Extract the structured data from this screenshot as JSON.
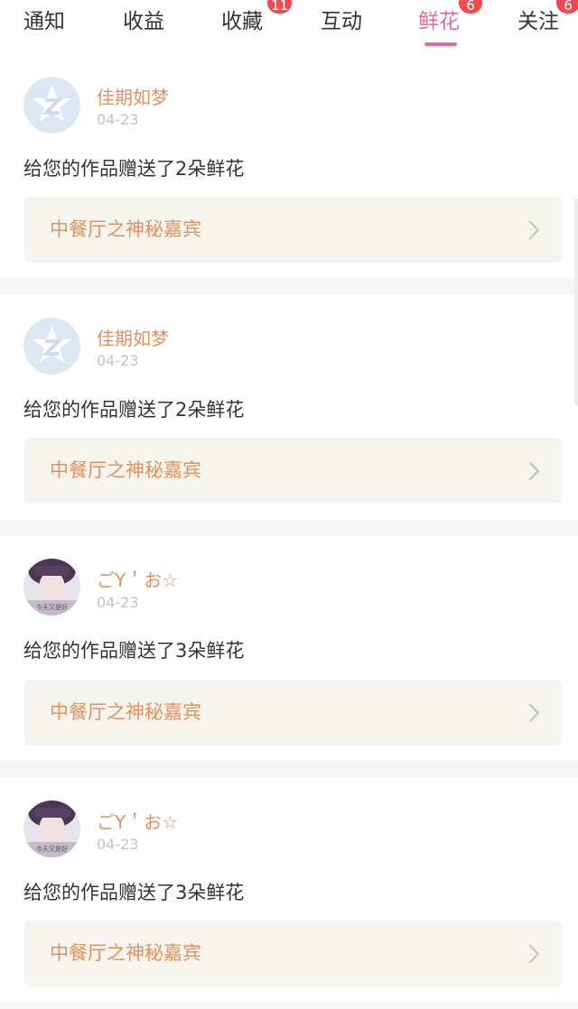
{
  "tabs": [
    {
      "label": "通知",
      "badge": ""
    },
    {
      "label": "收益",
      "badge": ""
    },
    {
      "label": "收藏",
      "badge": "11"
    },
    {
      "label": "互动",
      "badge": ""
    },
    {
      "label": "鲜花",
      "badge": "6"
    },
    {
      "label": "关注",
      "badge": "6"
    }
  ],
  "active_tab": "鲜花",
  "notifications": [
    {
      "user": "佳期如梦",
      "date": "04-23",
      "avatar": "qq-star-default-avatar",
      "message": "给您的作品赠送了2朵鲜花",
      "work": "中餐厅之神秘嘉宾"
    },
    {
      "user": "佳期如梦",
      "date": "04-23",
      "avatar": "qq-star-default-avatar",
      "message": "给您的作品赠送了2朵鲜花",
      "work": "中餐厅之神秘嘉宾"
    },
    {
      "user": "ごY＇お☆",
      "date": "04-23",
      "avatar": "user-photo-avatar",
      "message": "给您的作品赠送了3朵鲜花",
      "work": "中餐厅之神秘嘉宾"
    },
    {
      "user": "ごY＇お☆",
      "date": "04-23",
      "avatar": "user-photo-avatar",
      "message": "给您的作品赠送了3朵鲜花",
      "work": "中餐厅之神秘嘉宾"
    }
  ],
  "colors": {
    "accent": "#e7699f",
    "name": "#e2915d",
    "badge": "#ef4a4f",
    "card_bg": "#f6f4ee"
  }
}
